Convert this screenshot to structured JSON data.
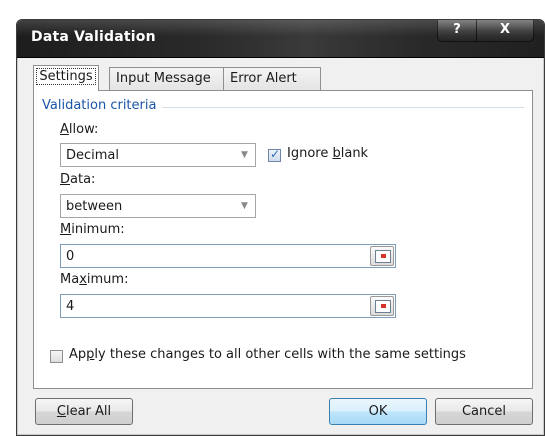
{
  "dialog": {
    "title": "Data Validation",
    "help_glyph": "?",
    "close_glyph": "X"
  },
  "tabs": [
    {
      "label": "Settings",
      "active": true
    },
    {
      "label": "Input Message",
      "active": false
    },
    {
      "label": "Error Alert",
      "active": false
    }
  ],
  "settings": {
    "group_label": "Validation criteria",
    "allow": {
      "label_pre": "",
      "label_key": "A",
      "label_post": "llow:",
      "value": "Decimal"
    },
    "ignore_blank": {
      "label_pre": "Ignore ",
      "label_key": "b",
      "label_post": "lank",
      "checked": true
    },
    "data": {
      "label_pre": "",
      "label_key": "D",
      "label_post": "ata:",
      "value": "between"
    },
    "minimum": {
      "label_pre": "",
      "label_key": "M",
      "label_post": "inimum:",
      "value": "0"
    },
    "maximum": {
      "label_pre": "Ma",
      "label_key": "x",
      "label_post": "imum:",
      "value": "4"
    },
    "apply_all": {
      "label_pre": "Ap",
      "label_key": "p",
      "label_post": "ly these changes to all other cells with the same settings",
      "checked": false
    }
  },
  "buttons": {
    "clear_all": {
      "label_pre": "",
      "label_key": "C",
      "label_post": "lear All"
    },
    "ok": "OK",
    "cancel": "Cancel"
  },
  "colors": {
    "group_label": "#1a55a8",
    "titlebar": "#2a2a2a",
    "ok_button": "#bee6fd"
  }
}
